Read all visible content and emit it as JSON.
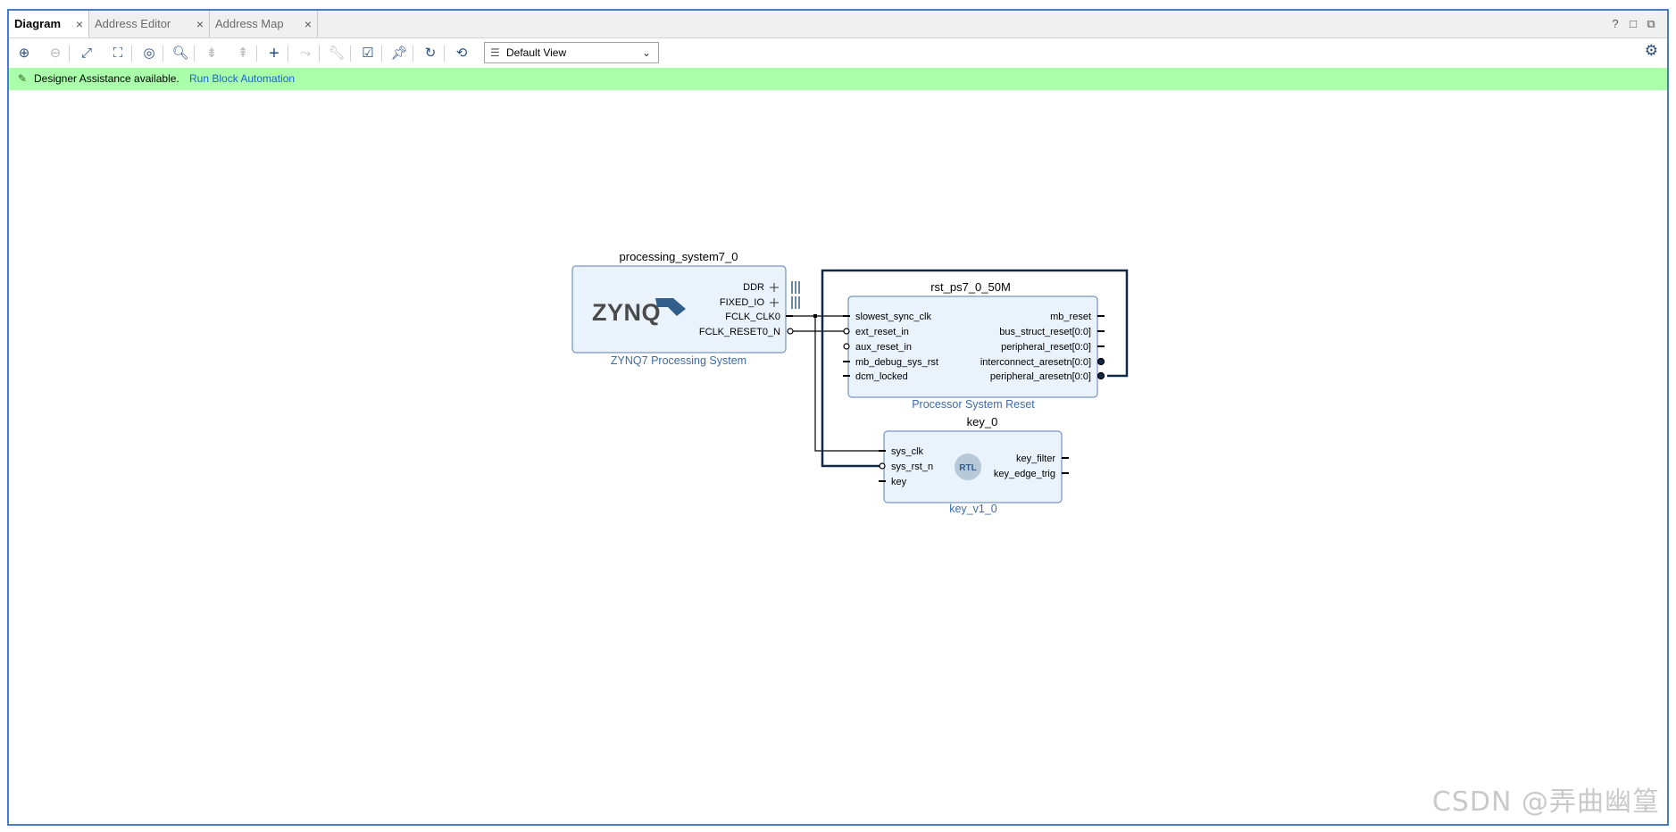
{
  "tabs": [
    {
      "label": "Diagram",
      "close": "×"
    },
    {
      "label": "Address Editor",
      "close": "×"
    },
    {
      "label": "Address Map",
      "close": "×"
    }
  ],
  "window_controls": {
    "help": "?",
    "restore": "□",
    "float": "⧉"
  },
  "toolbar": {
    "view_select": {
      "value": "Default View"
    }
  },
  "banner": {
    "message": "Designer Assistance available.",
    "link": "Run Block Automation"
  },
  "diagram": {
    "ps7": {
      "instance": "processing_system7_0",
      "type": "ZYNQ7 Processing System",
      "logo": "ZYNQ",
      "ports": [
        "DDR",
        "FIXED_IO",
        "FCLK_CLK0",
        "FCLK_RESET0_N"
      ]
    },
    "rst": {
      "instance": "rst_ps7_0_50M",
      "type": "Processor System Reset",
      "inputs": [
        "slowest_sync_clk",
        "ext_reset_in",
        "aux_reset_in",
        "mb_debug_sys_rst",
        "dcm_locked"
      ],
      "outputs": [
        "mb_reset",
        "bus_struct_reset[0:0]",
        "peripheral_reset[0:0]",
        "interconnect_aresetn[0:0]",
        "peripheral_aresetn[0:0]"
      ]
    },
    "key": {
      "instance": "key_0",
      "type": "key_v1_0",
      "badge": "RTL",
      "inputs": [
        "sys_clk",
        "sys_rst_n",
        "key"
      ],
      "outputs": [
        "key_filter",
        "key_edge_trig"
      ]
    }
  },
  "watermark": "CSDN @弄曲幽篁",
  "colors": {
    "frame": "#4a7cc4",
    "banner": "#aaffaa",
    "block_fill": "#eaf2fb",
    "block_stroke": "#5a7fb0",
    "link": "#1a5fd6",
    "type_label": "#3c6aa8"
  }
}
